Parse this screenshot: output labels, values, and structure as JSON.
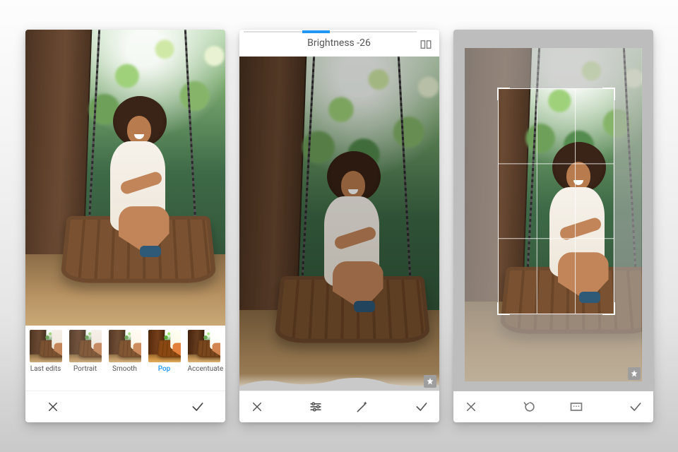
{
  "screen1": {
    "filters": [
      {
        "label": "Last edits",
        "selected": false
      },
      {
        "label": "Portrait",
        "selected": false
      },
      {
        "label": "Smooth",
        "selected": false
      },
      {
        "label": "Pop",
        "selected": true
      },
      {
        "label": "Accentuate",
        "selected": false
      }
    ],
    "cancel_label": "✕",
    "confirm_label": "✓"
  },
  "screen2": {
    "adjust_name": "Brightness",
    "adjust_value": "-26",
    "adjust_display": "Brightness -26",
    "cancel_label": "✕",
    "confirm_label": "✓"
  },
  "screen3": {
    "cancel_label": "✕",
    "confirm_label": "✓"
  },
  "colors": {
    "accent": "#2196f3"
  }
}
